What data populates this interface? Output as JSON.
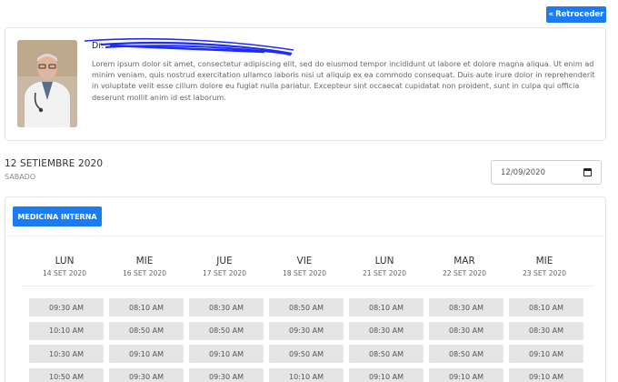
{
  "header": {
    "back_label": "Retroceder",
    "back_icon": "double-chevron-left-icon",
    "accent": "#1a7cf0"
  },
  "doctor": {
    "name": "Dr.",
    "description": "Lorem ipsum dolor sit amet, consectetur adipiscing elit, sed do eiusmod tempor incididunt ut labore et dolore magna aliqua. Ut enim ad minim veniam, quis nostrud exercitation ullamco laboris nisi ut aliquip ex ea commodo consequat. Duis aute irure dolor in reprehenderit in voluptate velit esse cillum dolore eu fugiat nulla pariatur. Excepteur sint occaecat cupidatat non proident, sunt in culpa qui officia deserunt mollit anim id est laborum."
  },
  "date": {
    "title": "12 SETIEMBRE 2020",
    "weekday": "SABADO",
    "input_value": "12/09/2020"
  },
  "schedule": {
    "specialty": "MEDICINA INTERNA",
    "days": [
      {
        "name": "LUN",
        "date": "14 SET 2020",
        "slots": [
          "09:30 AM",
          "10:10 AM",
          "10:30 AM",
          "10:50 AM"
        ]
      },
      {
        "name": "MIE",
        "date": "16 SET 2020",
        "slots": [
          "08:10 AM",
          "08:50 AM",
          "09:10 AM",
          "09:30 AM"
        ]
      },
      {
        "name": "JUE",
        "date": "17 SET 2020",
        "slots": [
          "08:30 AM",
          "08:50 AM",
          "09:10 AM",
          "09:30 AM"
        ]
      },
      {
        "name": "VIE",
        "date": "18 SET 2020",
        "slots": [
          "08:50 AM",
          "09:30 AM",
          "09:50 AM",
          "10:10 AM"
        ]
      },
      {
        "name": "LUN",
        "date": "21 SET 2020",
        "slots": [
          "08:10 AM",
          "08:30 AM",
          "08:50 AM",
          "09:10 AM"
        ]
      },
      {
        "name": "MAR",
        "date": "22 SET 2020",
        "slots": [
          "08:30 AM",
          "08:30 AM",
          "08:50 AM",
          "09:10 AM"
        ]
      },
      {
        "name": "MIE",
        "date": "23 SET 2020",
        "slots": [
          "08:10 AM",
          "08:30 AM",
          "09:10 AM",
          "09:10 AM"
        ]
      }
    ]
  }
}
